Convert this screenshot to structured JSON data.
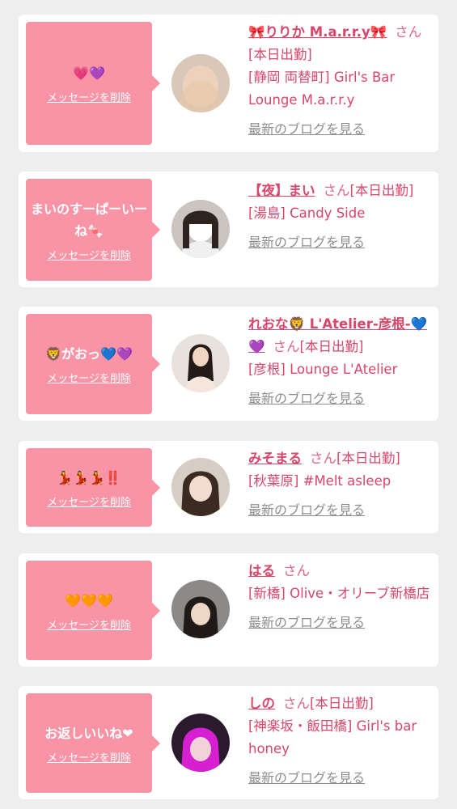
{
  "delete_label": "メッセージを削除",
  "blog_label": "最新のブログを見る",
  "san_label": "さん",
  "cards": [
    {
      "message": "💗💜",
      "name": "🎀りりか M.a.r.r.y🎀",
      "status": "[本日出勤]",
      "shop": "[静岡 両替町] Girl's Bar Lounge M.a.r.r.y"
    },
    {
      "message": "まいのすーぱーいーね🍬",
      "name": "【夜】まい",
      "status": "[本日出勤]",
      "shop": "[湯島] Candy Side"
    },
    {
      "message": "🦁がおっ💙💜",
      "name": "れおな🦁 L'Atelier-彦根-💙💜",
      "status": "[本日出勤]",
      "shop": "[彦根] Lounge L'Atelier"
    },
    {
      "message": "💃💃💃‼️",
      "name": "みそまる",
      "status": "[本日出勤]",
      "shop": "[秋葉原] #Melt asleep"
    },
    {
      "message": "🧡🧡🧡",
      "name": "はる",
      "status": "",
      "shop": "[新橋] Olive・オリーブ新橋店"
    },
    {
      "message": "お返しいいね❤",
      "name": "しの",
      "status": "[本日出勤]",
      "shop": "[神楽坂・飯田橋] Girl's bar honey"
    }
  ]
}
